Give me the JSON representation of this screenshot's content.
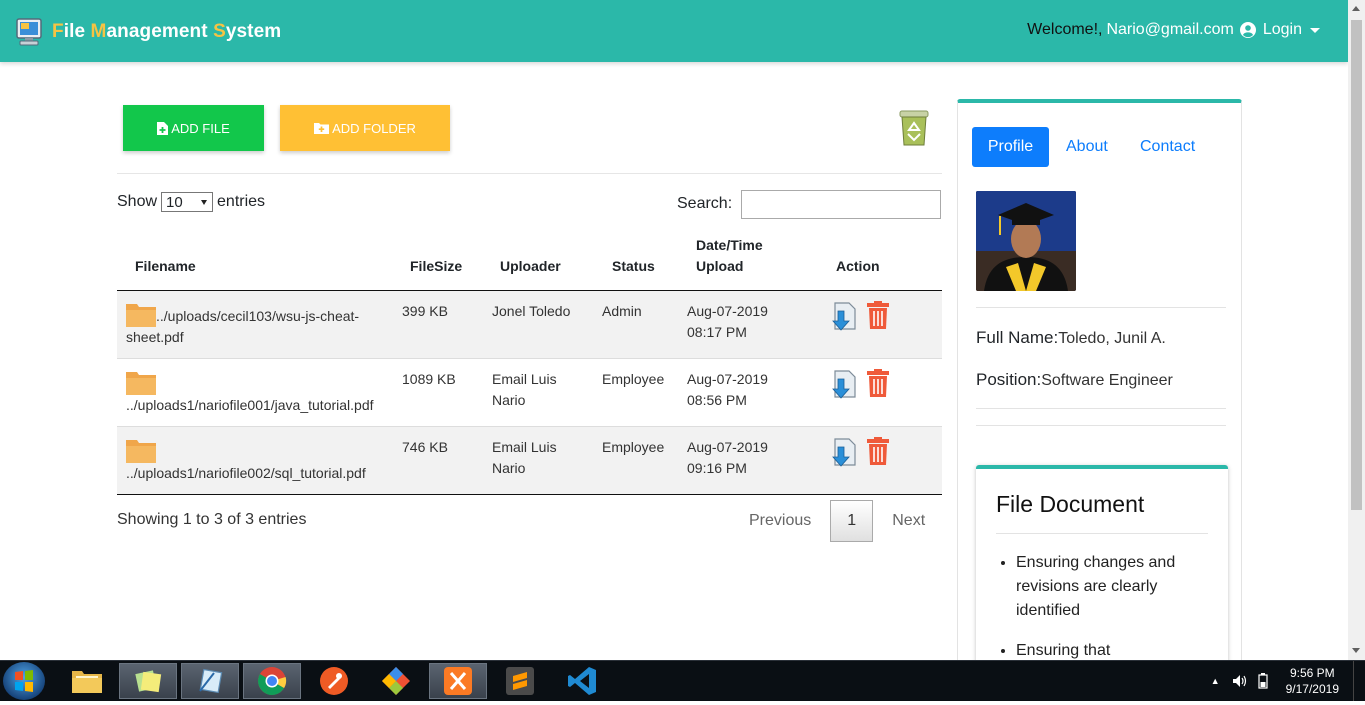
{
  "navbar": {
    "brand": {
      "f": "F",
      "ile": "ile ",
      "m": "M",
      "anagement": "anagement ",
      "s": "S",
      "ystem": "ystem"
    },
    "welcome": "Welcome!,",
    "email": "Nario@gmail.com",
    "login": "Login",
    "brand_color": "#2bb8a9",
    "highlight_color": "#f6c343"
  },
  "toolbar": {
    "add_file": "ADD FILE",
    "add_folder": "ADD FOLDER",
    "recycle_icon": "recycle-bin-icon"
  },
  "controls": {
    "show": "Show",
    "entries_value": "10",
    "entries": "entries",
    "search_label": "Search:",
    "search_value": ""
  },
  "table": {
    "headers": {
      "filename": "Filename",
      "filesize": "FileSize",
      "uploader": "Uploader",
      "status": "Status",
      "datetime_1": "Date/Time",
      "datetime_2": "Upload",
      "action": "Action"
    },
    "rows": [
      {
        "filename": "../uploads/cecil103/wsu-js-cheat-sheet.pdf",
        "size": "399 KB",
        "uploader": "Jonel Toledo",
        "status": "Admin",
        "date": "Aug-07-2019",
        "time": "08:17 PM"
      },
      {
        "filename": "../uploads1/nariofile001/java_tutorial.pdf",
        "size": "1089 KB",
        "uploader": "Email Luis Nario",
        "status": "Employee",
        "date": "Aug-07-2019",
        "time": "08:56 PM"
      },
      {
        "filename": "../uploads1/nariofile002/sql_tutorial.pdf",
        "size": "746 KB",
        "uploader": "Email Luis Nario",
        "status": "Employee",
        "date": "Aug-07-2019",
        "time": "09:16 PM"
      }
    ],
    "info": "Showing 1 to 3 of 3 entries",
    "pagination": {
      "previous": "Previous",
      "page": "1",
      "next": "Next"
    }
  },
  "sidebar": {
    "tabs": {
      "profile": "Profile",
      "about": "About",
      "contact": "Contact"
    },
    "full_name_label": "Full Name:",
    "full_name": "Toledo, Junil A.",
    "position_label": "Position:",
    "position": "Software Engineer",
    "doc_title": "File Document",
    "doc_items": [
      "Ensuring changes and revisions are clearly identified",
      "Ensuring that"
    ]
  },
  "taskbar": {
    "apps": [
      "file-explorer-icon",
      "sticky-notes-icon",
      "snipping-tool-icon",
      "chrome-icon",
      "postman-icon",
      "git-icon",
      "xampp-icon",
      "sublime-text-icon",
      "vscode-icon"
    ],
    "time": "9:56 PM",
    "date": "9/17/2019"
  }
}
